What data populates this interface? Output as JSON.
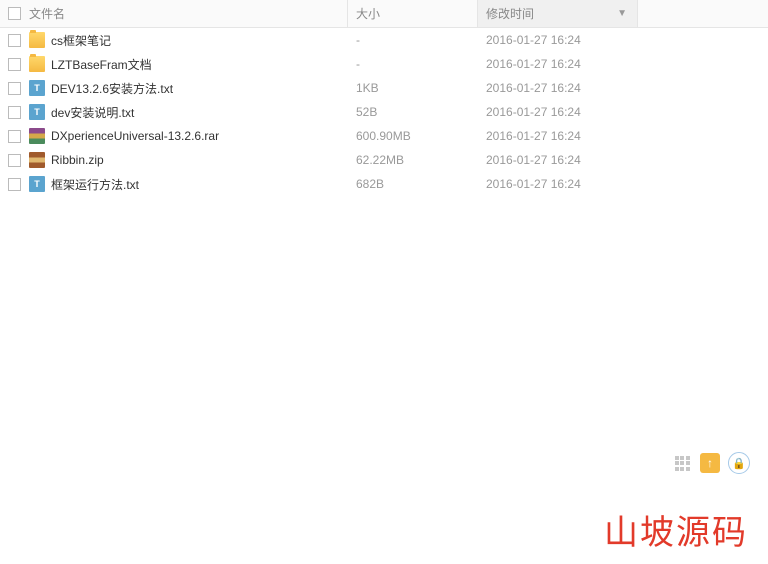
{
  "columns": {
    "name": "文件名",
    "size": "大小",
    "mtime": "修改时间"
  },
  "sort_indicator": "▼",
  "files": [
    {
      "name": "cs框架笔记",
      "type": "folder",
      "size": "-",
      "mtime": "2016-01-27 16:24"
    },
    {
      "name": "LZTBaseFram文档",
      "type": "folder",
      "size": "-",
      "mtime": "2016-01-27 16:24"
    },
    {
      "name": "DEV13.2.6安装方法.txt",
      "type": "txt",
      "size": "1KB",
      "mtime": "2016-01-27 16:24"
    },
    {
      "name": "dev安装说明.txt",
      "type": "txt",
      "size": "52B",
      "mtime": "2016-01-27 16:24"
    },
    {
      "name": "DXperienceUniversal-13.2.6.rar",
      "type": "rar",
      "size": "600.90MB",
      "mtime": "2016-01-27 16:24"
    },
    {
      "name": "Ribbin.zip",
      "type": "zip",
      "size": "62.22MB",
      "mtime": "2016-01-27 16:24"
    },
    {
      "name": "框架运行方法.txt",
      "type": "txt",
      "size": "682B",
      "mtime": "2016-01-27 16:24"
    }
  ],
  "icons": {
    "txt_label": "T",
    "upload": "↑",
    "lock": "🔒"
  },
  "watermark": "山坡源码"
}
